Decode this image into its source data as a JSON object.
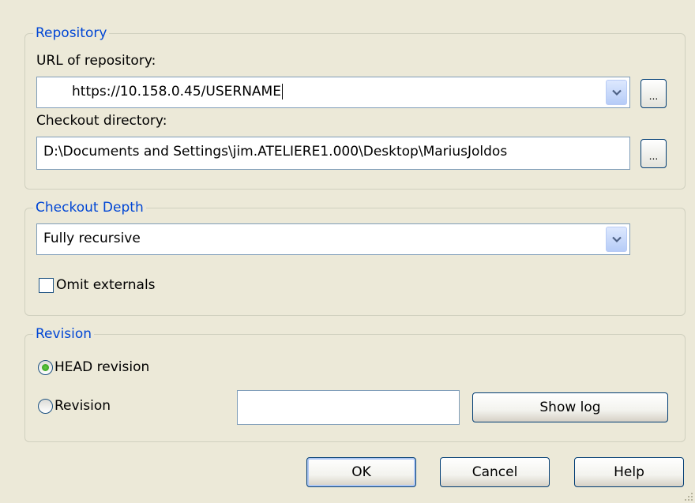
{
  "repository": {
    "legend": "Repository",
    "url_label": "URL of repository:",
    "url_value": "https://10.158.0.45/USERNAME",
    "checkout_label": "Checkout directory:",
    "checkout_value": "D:\\Documents and Settings\\jim.ATELIERE1.000\\Desktop\\MariusJoldos",
    "browse_label": "..."
  },
  "depth": {
    "legend": "Checkout Depth",
    "selected": "Fully recursive",
    "omit_label": "Omit externals",
    "omit_checked": false
  },
  "revision": {
    "legend": "Revision",
    "head_label": "HEAD revision",
    "revision_label": "Revision",
    "selected": "head",
    "revision_value": "",
    "show_log_label": "Show log"
  },
  "buttons": {
    "ok": "OK",
    "cancel": "Cancel",
    "help": "Help"
  }
}
